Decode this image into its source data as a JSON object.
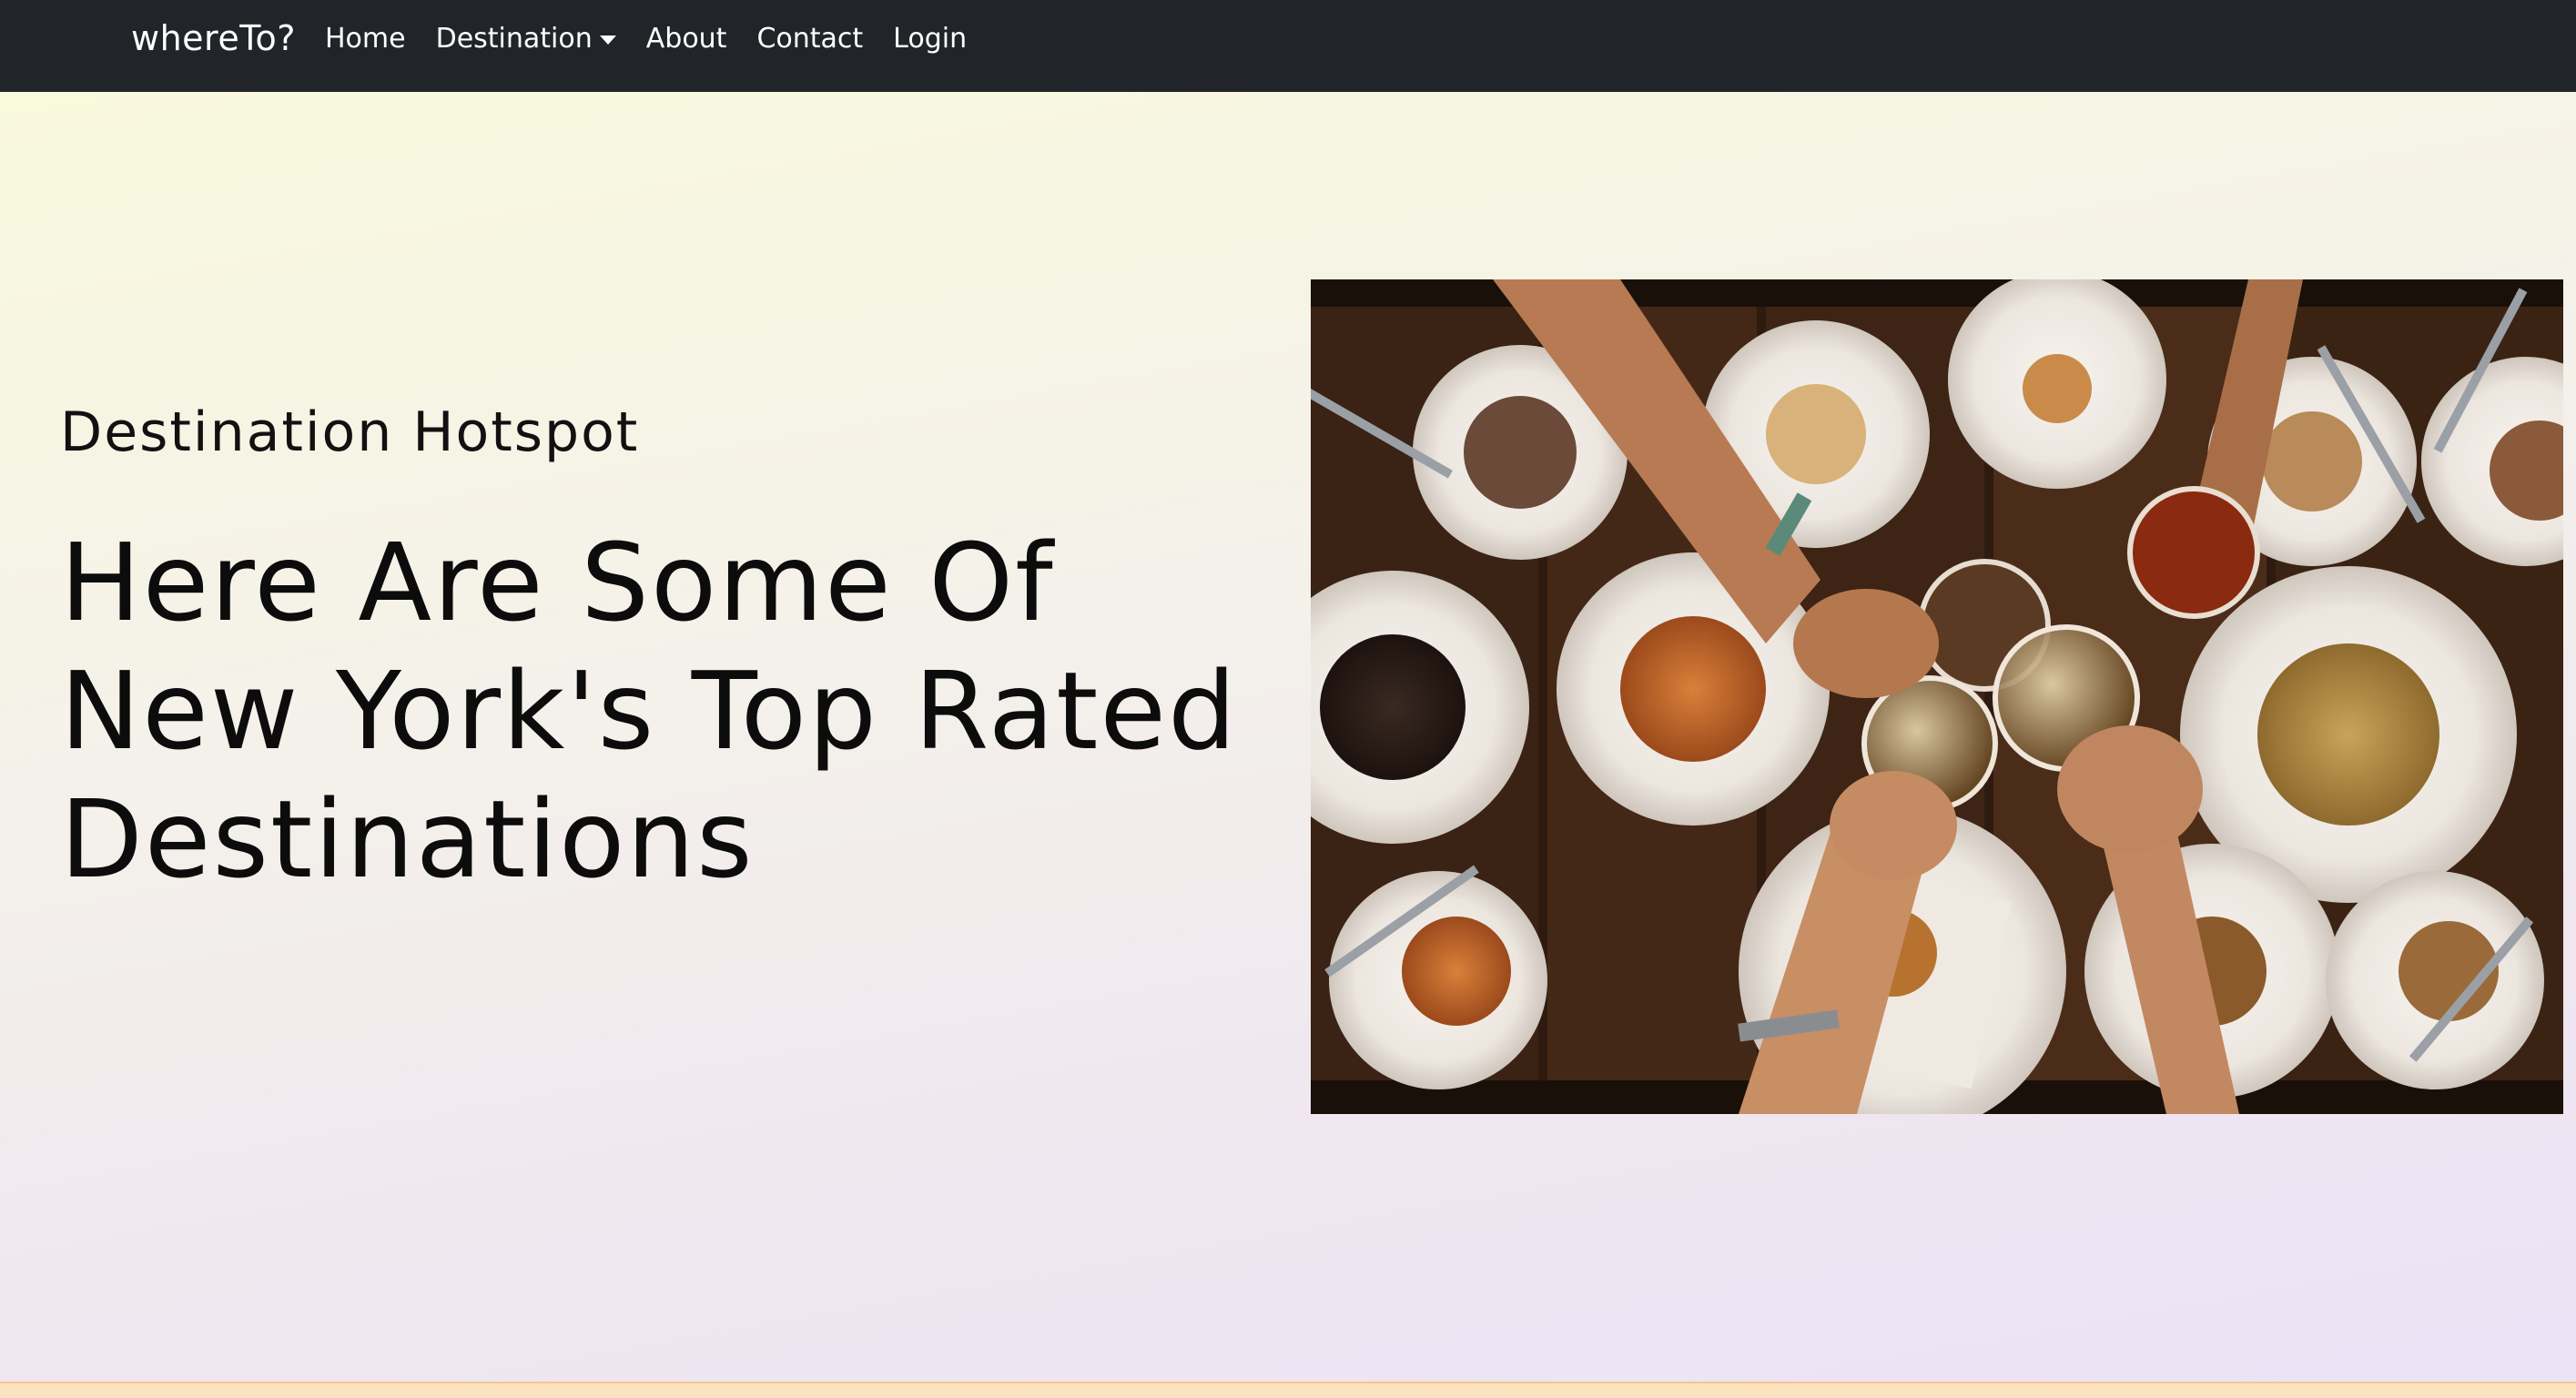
{
  "navbar": {
    "brand": "whereTo?",
    "links": [
      {
        "label": "Home"
      },
      {
        "label": "Destination"
      },
      {
        "label": "About"
      },
      {
        "label": "Contact"
      },
      {
        "label": "Login"
      }
    ]
  },
  "hero": {
    "subtitle": "Destination Hotspot",
    "headline": "Here Are Some Of New York's Top Rated Destinations"
  },
  "colors": {
    "navbar_bg": "#212529",
    "footer_strip": "#fbe3bf"
  }
}
